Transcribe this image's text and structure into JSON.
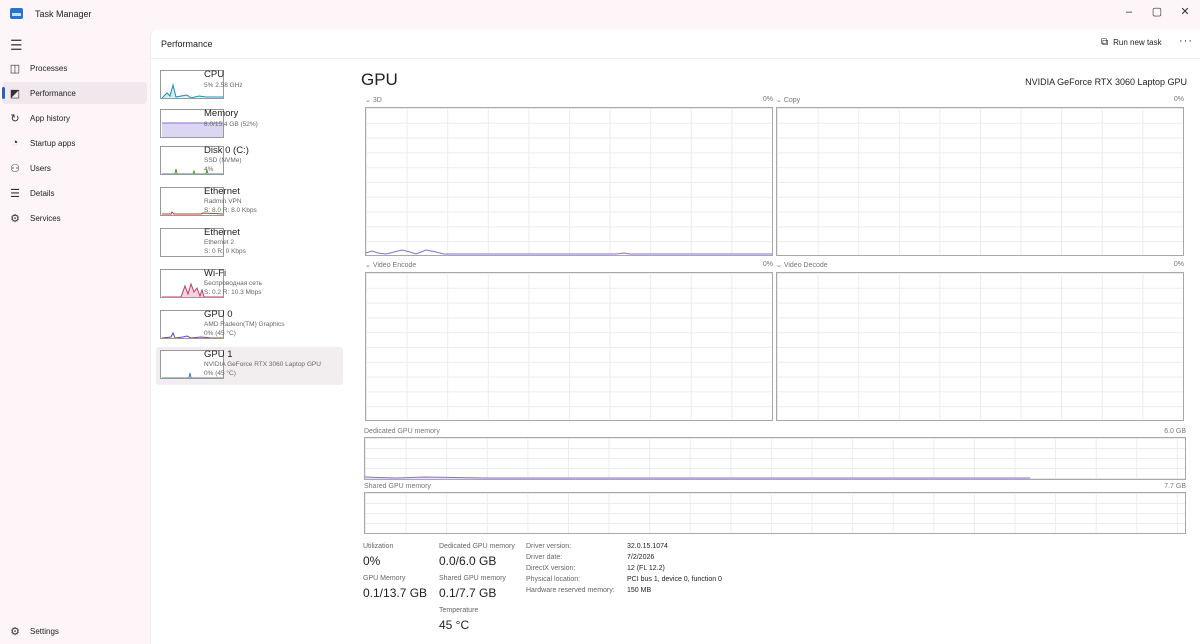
{
  "window": {
    "title": "Task Manager",
    "controls": [
      "–",
      "▢",
      "✕"
    ]
  },
  "nav": {
    "items": [
      {
        "label": "Processes",
        "icon": "processes-icon",
        "glyph": "◫"
      },
      {
        "label": "Performance",
        "icon": "performance-icon",
        "glyph": "◩"
      },
      {
        "label": "App history",
        "icon": "history-icon",
        "glyph": "↻"
      },
      {
        "label": "Startup apps",
        "icon": "startup-icon",
        "glyph": "◔"
      },
      {
        "label": "Users",
        "icon": "users-icon",
        "glyph": "⚇"
      },
      {
        "label": "Details",
        "icon": "details-icon",
        "glyph": "☰"
      },
      {
        "label": "Services",
        "icon": "services-icon",
        "glyph": "⚙"
      }
    ],
    "active": "Performance",
    "settings_label": "Settings"
  },
  "header": {
    "title": "Performance",
    "run_new_task": "Run new task",
    "more": "···"
  },
  "devices": [
    {
      "name": "CPU",
      "sub": [
        "5% 2.58 GHz"
      ],
      "color": "#1a8fb4"
    },
    {
      "name": "Memory",
      "sub": [
        "8.0/15.4 GB (52%)"
      ],
      "color": "#8a6fd1"
    },
    {
      "name": "Disk 0 (C:)",
      "sub": [
        "SSD (NVMe)",
        "4%"
      ],
      "color": "#4d9a28"
    },
    {
      "name": "Ethernet",
      "sub": [
        "Radmin VPN",
        "S: 8.0 R: 8.0 Kbps"
      ],
      "color": "#c0392b"
    },
    {
      "name": "Ethernet",
      "sub": [
        "Ethernet 2",
        "S: 0 R: 0 Kbps"
      ],
      "color": "#c0392b"
    },
    {
      "name": "Wi-Fi",
      "sub": [
        "Беспроводная сеть",
        "S: 0.2 R: 10.3 Mbps"
      ],
      "color": "#c23b6d"
    },
    {
      "name": "GPU 0",
      "sub": [
        "AMD Radeon(TM) Graphics",
        "0% (45 °C)"
      ],
      "color": "#6a3fc8"
    },
    {
      "name": "GPU 1",
      "sub": [
        "NVIDIA GeForce RTX 3060 Laptop GPU",
        "0% (45 °C)"
      ],
      "color": "#3b7fc4"
    }
  ],
  "gpu": {
    "title": "GPU",
    "model": "NVIDIA GeForce RTX 3060 Laptop GPU",
    "engines": [
      {
        "label": "3D",
        "value": "0%"
      },
      {
        "label": "Copy",
        "value": "0%"
      },
      {
        "label": "Video Encode",
        "value": "0%"
      },
      {
        "label": "Video Decode",
        "value": "0%"
      }
    ],
    "dedicated_label": "Dedicated GPU memory",
    "dedicated_max": "6.0 GB",
    "shared_label": "Shared GPU memory",
    "shared_max": "7.7 GB",
    "accent": "#8a6fd1"
  },
  "stats": {
    "utilization_label": "Utilization",
    "utilization": "0%",
    "dedicated_label": "Dedicated GPU memory",
    "dedicated": "0.0/6.0 GB",
    "gpu_memory_label": "GPU Memory",
    "gpu_memory": "0.1/13.7 GB",
    "shared_label": "Shared GPU memory",
    "shared": "0.1/7.7 GB",
    "temp_label": "Temperature",
    "temp": "45 °C"
  },
  "info": [
    {
      "label": "Driver version:",
      "value": "32.0.15.1074"
    },
    {
      "label": "Driver date:",
      "value": "7/2/2026"
    },
    {
      "label": "DirectX version:",
      "value": "12 (FL 12.2)"
    },
    {
      "label": "Physical location:",
      "value": "PCI bus 1, device 0, function 0"
    },
    {
      "label": "Hardware reserved memory:",
      "value": "150 MB"
    }
  ]
}
